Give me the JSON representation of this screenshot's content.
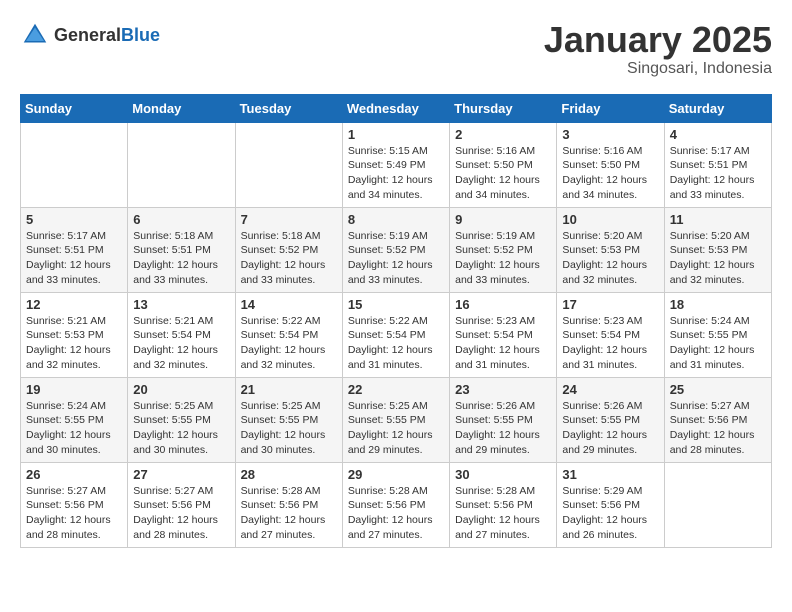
{
  "header": {
    "logo_general": "General",
    "logo_blue": "Blue",
    "month_title": "January 2025",
    "location": "Singosari, Indonesia"
  },
  "days_of_week": [
    "Sunday",
    "Monday",
    "Tuesday",
    "Wednesday",
    "Thursday",
    "Friday",
    "Saturday"
  ],
  "weeks": [
    [
      {
        "day": "",
        "sunrise": "",
        "sunset": "",
        "daylight": ""
      },
      {
        "day": "",
        "sunrise": "",
        "sunset": "",
        "daylight": ""
      },
      {
        "day": "",
        "sunrise": "",
        "sunset": "",
        "daylight": ""
      },
      {
        "day": "1",
        "sunrise": "Sunrise: 5:15 AM",
        "sunset": "Sunset: 5:49 PM",
        "daylight": "Daylight: 12 hours and 34 minutes."
      },
      {
        "day": "2",
        "sunrise": "Sunrise: 5:16 AM",
        "sunset": "Sunset: 5:50 PM",
        "daylight": "Daylight: 12 hours and 34 minutes."
      },
      {
        "day": "3",
        "sunrise": "Sunrise: 5:16 AM",
        "sunset": "Sunset: 5:50 PM",
        "daylight": "Daylight: 12 hours and 34 minutes."
      },
      {
        "day": "4",
        "sunrise": "Sunrise: 5:17 AM",
        "sunset": "Sunset: 5:51 PM",
        "daylight": "Daylight: 12 hours and 33 minutes."
      }
    ],
    [
      {
        "day": "5",
        "sunrise": "Sunrise: 5:17 AM",
        "sunset": "Sunset: 5:51 PM",
        "daylight": "Daylight: 12 hours and 33 minutes."
      },
      {
        "day": "6",
        "sunrise": "Sunrise: 5:18 AM",
        "sunset": "Sunset: 5:51 PM",
        "daylight": "Daylight: 12 hours and 33 minutes."
      },
      {
        "day": "7",
        "sunrise": "Sunrise: 5:18 AM",
        "sunset": "Sunset: 5:52 PM",
        "daylight": "Daylight: 12 hours and 33 minutes."
      },
      {
        "day": "8",
        "sunrise": "Sunrise: 5:19 AM",
        "sunset": "Sunset: 5:52 PM",
        "daylight": "Daylight: 12 hours and 33 minutes."
      },
      {
        "day": "9",
        "sunrise": "Sunrise: 5:19 AM",
        "sunset": "Sunset: 5:52 PM",
        "daylight": "Daylight: 12 hours and 33 minutes."
      },
      {
        "day": "10",
        "sunrise": "Sunrise: 5:20 AM",
        "sunset": "Sunset: 5:53 PM",
        "daylight": "Daylight: 12 hours and 32 minutes."
      },
      {
        "day": "11",
        "sunrise": "Sunrise: 5:20 AM",
        "sunset": "Sunset: 5:53 PM",
        "daylight": "Daylight: 12 hours and 32 minutes."
      }
    ],
    [
      {
        "day": "12",
        "sunrise": "Sunrise: 5:21 AM",
        "sunset": "Sunset: 5:53 PM",
        "daylight": "Daylight: 12 hours and 32 minutes."
      },
      {
        "day": "13",
        "sunrise": "Sunrise: 5:21 AM",
        "sunset": "Sunset: 5:54 PM",
        "daylight": "Daylight: 12 hours and 32 minutes."
      },
      {
        "day": "14",
        "sunrise": "Sunrise: 5:22 AM",
        "sunset": "Sunset: 5:54 PM",
        "daylight": "Daylight: 12 hours and 32 minutes."
      },
      {
        "day": "15",
        "sunrise": "Sunrise: 5:22 AM",
        "sunset": "Sunset: 5:54 PM",
        "daylight": "Daylight: 12 hours and 31 minutes."
      },
      {
        "day": "16",
        "sunrise": "Sunrise: 5:23 AM",
        "sunset": "Sunset: 5:54 PM",
        "daylight": "Daylight: 12 hours and 31 minutes."
      },
      {
        "day": "17",
        "sunrise": "Sunrise: 5:23 AM",
        "sunset": "Sunset: 5:54 PM",
        "daylight": "Daylight: 12 hours and 31 minutes."
      },
      {
        "day": "18",
        "sunrise": "Sunrise: 5:24 AM",
        "sunset": "Sunset: 5:55 PM",
        "daylight": "Daylight: 12 hours and 31 minutes."
      }
    ],
    [
      {
        "day": "19",
        "sunrise": "Sunrise: 5:24 AM",
        "sunset": "Sunset: 5:55 PM",
        "daylight": "Daylight: 12 hours and 30 minutes."
      },
      {
        "day": "20",
        "sunrise": "Sunrise: 5:25 AM",
        "sunset": "Sunset: 5:55 PM",
        "daylight": "Daylight: 12 hours and 30 minutes."
      },
      {
        "day": "21",
        "sunrise": "Sunrise: 5:25 AM",
        "sunset": "Sunset: 5:55 PM",
        "daylight": "Daylight: 12 hours and 30 minutes."
      },
      {
        "day": "22",
        "sunrise": "Sunrise: 5:25 AM",
        "sunset": "Sunset: 5:55 PM",
        "daylight": "Daylight: 12 hours and 29 minutes."
      },
      {
        "day": "23",
        "sunrise": "Sunrise: 5:26 AM",
        "sunset": "Sunset: 5:55 PM",
        "daylight": "Daylight: 12 hours and 29 minutes."
      },
      {
        "day": "24",
        "sunrise": "Sunrise: 5:26 AM",
        "sunset": "Sunset: 5:55 PM",
        "daylight": "Daylight: 12 hours and 29 minutes."
      },
      {
        "day": "25",
        "sunrise": "Sunrise: 5:27 AM",
        "sunset": "Sunset: 5:56 PM",
        "daylight": "Daylight: 12 hours and 28 minutes."
      }
    ],
    [
      {
        "day": "26",
        "sunrise": "Sunrise: 5:27 AM",
        "sunset": "Sunset: 5:56 PM",
        "daylight": "Daylight: 12 hours and 28 minutes."
      },
      {
        "day": "27",
        "sunrise": "Sunrise: 5:27 AM",
        "sunset": "Sunset: 5:56 PM",
        "daylight": "Daylight: 12 hours and 28 minutes."
      },
      {
        "day": "28",
        "sunrise": "Sunrise: 5:28 AM",
        "sunset": "Sunset: 5:56 PM",
        "daylight": "Daylight: 12 hours and 27 minutes."
      },
      {
        "day": "29",
        "sunrise": "Sunrise: 5:28 AM",
        "sunset": "Sunset: 5:56 PM",
        "daylight": "Daylight: 12 hours and 27 minutes."
      },
      {
        "day": "30",
        "sunrise": "Sunrise: 5:28 AM",
        "sunset": "Sunset: 5:56 PM",
        "daylight": "Daylight: 12 hours and 27 minutes."
      },
      {
        "day": "31",
        "sunrise": "Sunrise: 5:29 AM",
        "sunset": "Sunset: 5:56 PM",
        "daylight": "Daylight: 12 hours and 26 minutes."
      },
      {
        "day": "",
        "sunrise": "",
        "sunset": "",
        "daylight": ""
      }
    ]
  ]
}
